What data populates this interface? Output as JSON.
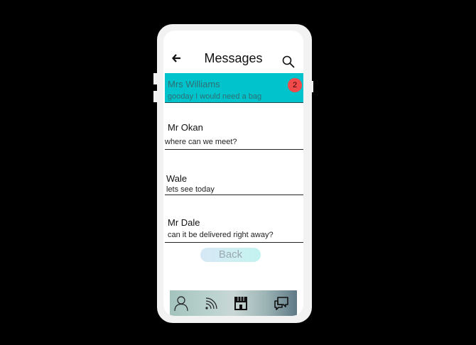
{
  "header": {
    "title": "Messages",
    "back_icon": "arrow-left-icon",
    "search_icon": "search-icon"
  },
  "messages": [
    {
      "name": "Mrs Williams",
      "preview": "gooday I would need a bag",
      "unread": "2",
      "highlighted": true
    },
    {
      "name": "Mr Okan",
      "preview": "where can we meet?"
    },
    {
      "name": "Wale",
      "preview": "lets see today"
    },
    {
      "name": "Mr Dale",
      "preview": "can it be delivered right away?"
    }
  ],
  "back_button": {
    "label": "Back"
  },
  "bottom_nav": {
    "items": [
      {
        "icon": "profile-icon"
      },
      {
        "icon": "feed-icon"
      },
      {
        "icon": "store-icon"
      },
      {
        "icon": "chat-icon"
      }
    ]
  },
  "colors": {
    "highlight": "#00c3cc",
    "badge": "#f04a4a",
    "background": "#000000",
    "phone": "#f2f2f2"
  }
}
